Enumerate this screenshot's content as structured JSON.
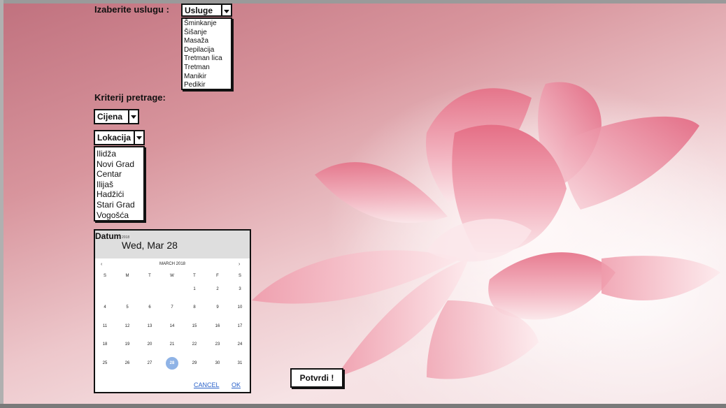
{
  "services": {
    "label": "Izaberite uslugu :",
    "selected": "Usluge",
    "options": [
      "Šminkanje",
      "Šišanje",
      "Masaža",
      "Depilacija",
      "Tretman lica",
      "Tretman",
      "Manikir",
      "Pedikir"
    ]
  },
  "criteria": {
    "label": "Kriterij pretrage:",
    "price_selected": "Cijena",
    "location_selected": "Lokacija",
    "locations": [
      "Ilidža",
      "Novi Grad",
      "Centar",
      "Ilijaš",
      "Hadžići",
      "Stari Grad",
      "Vogošća"
    ]
  },
  "datepicker": {
    "title": "Datum",
    "year": "2018",
    "header_date": "Wed, Mar 28",
    "month_label": "MARCH 2018",
    "prev": "‹",
    "next": "›",
    "weekdays": [
      "S",
      "M",
      "T",
      "W",
      "T",
      "F",
      "S"
    ],
    "weeks": [
      [
        "",
        "",
        "",
        "",
        "1",
        "2",
        "3"
      ],
      [
        "4",
        "5",
        "6",
        "7",
        "8",
        "9",
        "10"
      ],
      [
        "11",
        "12",
        "13",
        "14",
        "15",
        "16",
        "17"
      ],
      [
        "18",
        "19",
        "20",
        "21",
        "22",
        "23",
        "24"
      ],
      [
        "25",
        "26",
        "27",
        "28",
        "29",
        "30",
        "31"
      ]
    ],
    "selected_day": "28",
    "cancel": "CANCEL",
    "ok": "OK"
  },
  "confirm_label": "Potvrdi !",
  "colors": {
    "selected_day": "#8fb3e6",
    "link": "#2a62c9",
    "lotus_petal": "#e88ea0"
  }
}
